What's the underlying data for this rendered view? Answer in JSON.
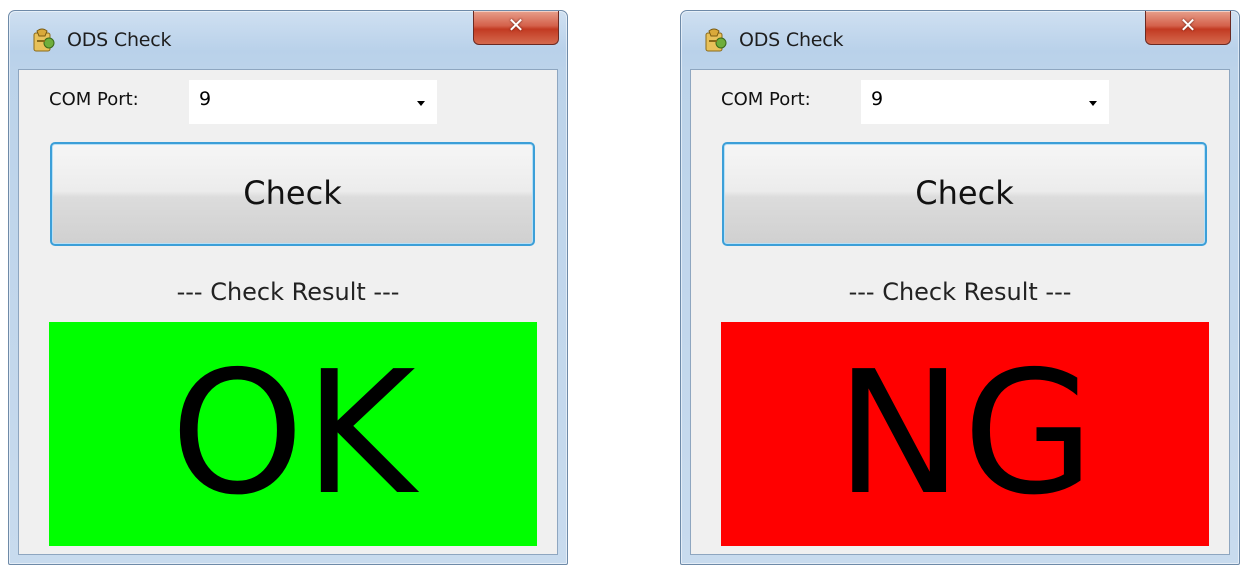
{
  "windows": [
    {
      "title": "ODS Check",
      "close_label": "✕",
      "com_port_label": "COM Port:",
      "com_port_value": "9",
      "check_label": "Check",
      "result_caption": "--- Check Result ---",
      "result_text": "OK",
      "result_color": "#00ff00"
    },
    {
      "title": "ODS Check",
      "close_label": "✕",
      "com_port_label": "COM Port:",
      "com_port_value": "9",
      "check_label": "Check",
      "result_caption": "--- Check Result ---",
      "result_text": "NG",
      "result_color": "#ff0000"
    }
  ],
  "colors": {
    "ok": "#00ff00",
    "ng": "#ff0000",
    "button_border": "#3c9fd8"
  },
  "icons": {
    "app": "ods-app-icon",
    "close": "close-icon",
    "dropdown": "chevron-down-icon"
  }
}
